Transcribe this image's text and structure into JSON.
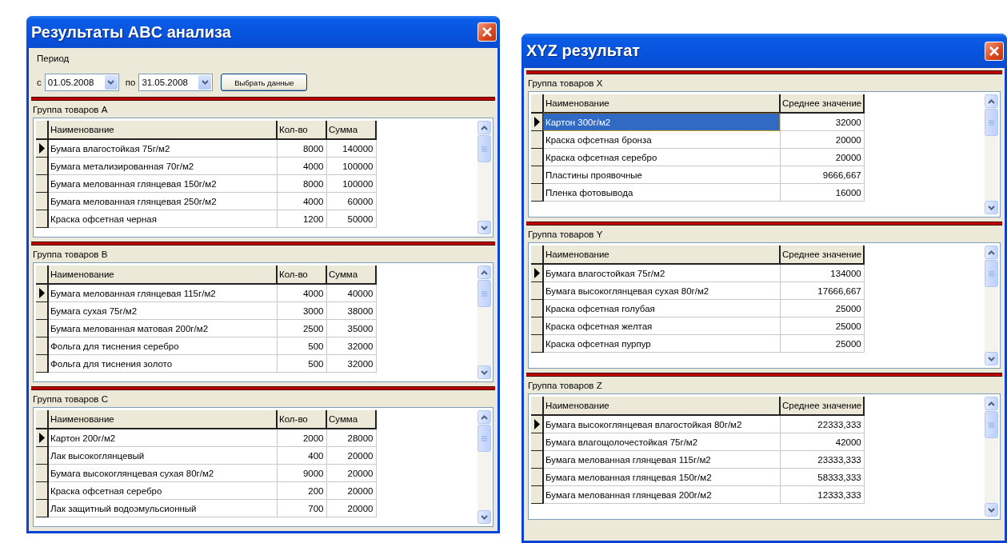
{
  "windows": [
    {
      "title": "Результаты ABC анализа",
      "period": {
        "label": "Период",
        "from_label": "с",
        "from": "01.05.2008",
        "to_label": "по",
        "to": "31.05.2008",
        "button": "Выбрать данные"
      },
      "groups": [
        {
          "label": "Группа товаров A",
          "columns": [
            "Наименование",
            "Кол-во",
            "Сумма"
          ],
          "rows": [
            {
              "selected": true,
              "focused": false,
              "cells": [
                "Бумага влагостойкая 75г/м2",
                "8000",
                "140000"
              ]
            },
            {
              "selected": false,
              "focused": false,
              "cells": [
                "Бумага метализированная 70г/м2",
                "4000",
                "100000"
              ]
            },
            {
              "selected": false,
              "focused": false,
              "cells": [
                "Бумага мелованная глянцевая 150г/м2",
                "8000",
                "100000"
              ]
            },
            {
              "selected": false,
              "focused": false,
              "cells": [
                "Бумага мелованная глянцевая 250г/м2",
                "4000",
                "60000"
              ]
            },
            {
              "selected": false,
              "focused": false,
              "cells": [
                "Краска офсетная черная",
                "1200",
                "50000"
              ]
            }
          ]
        },
        {
          "label": "Группа товаров B",
          "columns": [
            "Наименование",
            "Кол-во",
            "Сумма"
          ],
          "rows": [
            {
              "selected": true,
              "focused": false,
              "cells": [
                "Бумага мелованная глянцевая 115г/м2",
                "4000",
                "40000"
              ]
            },
            {
              "selected": false,
              "focused": false,
              "cells": [
                "Бумага сухая 75г/м2",
                "3000",
                "38000"
              ]
            },
            {
              "selected": false,
              "focused": false,
              "cells": [
                "Бумага мелованная матовая 200г/м2",
                "2500",
                "35000"
              ]
            },
            {
              "selected": false,
              "focused": false,
              "cells": [
                "Фольга для тиснения серебро",
                "500",
                "32000"
              ]
            },
            {
              "selected": false,
              "focused": false,
              "cells": [
                "Фольга для тиснения золото",
                "500",
                "32000"
              ]
            }
          ]
        },
        {
          "label": "Группа товаров C",
          "columns": [
            "Наименование",
            "Кол-во",
            "Сумма"
          ],
          "rows": [
            {
              "selected": true,
              "focused": false,
              "cells": [
                "Картон 200г/м2",
                "2000",
                "28000"
              ]
            },
            {
              "selected": false,
              "focused": false,
              "cells": [
                "Лак высокоглянцевый",
                "400",
                "20000"
              ]
            },
            {
              "selected": false,
              "focused": false,
              "cells": [
                "Бумага высокоглянцевая сухая 80г/м2",
                "9000",
                "20000"
              ]
            },
            {
              "selected": false,
              "focused": false,
              "cells": [
                "Краска офсетная серебро",
                "200",
                "20000"
              ]
            },
            {
              "selected": false,
              "focused": false,
              "cells": [
                "Лак защитный водоэмульсионный",
                "700",
                "20000"
              ]
            }
          ]
        }
      ]
    },
    {
      "title": "XYZ результат",
      "groups": [
        {
          "label": "Группа товаров X",
          "columns": [
            "Наименование",
            "Среднее значение"
          ],
          "rows": [
            {
              "selected": true,
              "focused": true,
              "cells": [
                "Картон 300г/м2",
                "32000"
              ]
            },
            {
              "selected": false,
              "focused": false,
              "cells": [
                "Краска офсетная бронза",
                "20000"
              ]
            },
            {
              "selected": false,
              "focused": false,
              "cells": [
                "Краска офсетная серебро",
                "20000"
              ]
            },
            {
              "selected": false,
              "focused": false,
              "cells": [
                "Пластины проявочные",
                "9666,667"
              ]
            },
            {
              "selected": false,
              "focused": false,
              "cells": [
                "Пленка фотовывода",
                "16000"
              ]
            }
          ]
        },
        {
          "label": "Группа товаров Y",
          "columns": [
            "Наименование",
            "Среднее значение"
          ],
          "rows": [
            {
              "selected": true,
              "focused": false,
              "cells": [
                "Бумага влагостойкая 75г/м2",
                "134000"
              ]
            },
            {
              "selected": false,
              "focused": false,
              "cells": [
                "Бумага высокоглянцевая сухая 80г/м2",
                "17666,667"
              ]
            },
            {
              "selected": false,
              "focused": false,
              "cells": [
                "Краска офсетная голубая",
                "25000"
              ]
            },
            {
              "selected": false,
              "focused": false,
              "cells": [
                "Краска офсетная желтая",
                "25000"
              ]
            },
            {
              "selected": false,
              "focused": false,
              "cells": [
                "Краска офсетная пурпур",
                "25000"
              ]
            }
          ]
        },
        {
          "label": "Группа товаров Z",
          "columns": [
            "Наименование",
            "Среднее значение"
          ],
          "rows": [
            {
              "selected": true,
              "focused": false,
              "cells": [
                "Бумага  высокоглянцевая влагостойкая 80г/м2",
                "22333,333"
              ]
            },
            {
              "selected": false,
              "focused": false,
              "cells": [
                "Бумага влагощолочестойкая 75г/м2",
                "42000"
              ]
            },
            {
              "selected": false,
              "focused": false,
              "cells": [
                "Бумага мелованная глянцевая 115г/м2",
                "23333,333"
              ]
            },
            {
              "selected": false,
              "focused": false,
              "cells": [
                "Бумага мелованная глянцевая 150г/м2",
                "58333,333"
              ]
            },
            {
              "selected": false,
              "focused": false,
              "cells": [
                "Бумага мелованная глянцевая 200г/м2",
                "12333,333"
              ]
            }
          ]
        }
      ]
    }
  ]
}
